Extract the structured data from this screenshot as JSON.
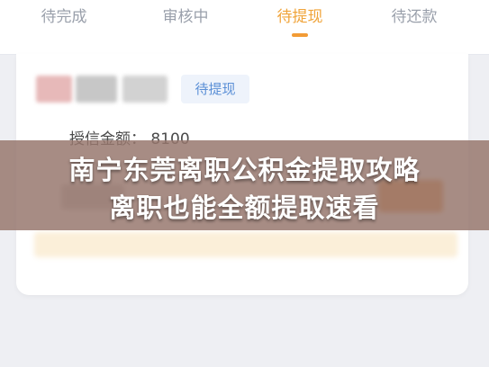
{
  "tabs": [
    {
      "label": "待完成",
      "active": false
    },
    {
      "label": "审核中",
      "active": false
    },
    {
      "label": "待提现",
      "active": true
    },
    {
      "label": "待还款",
      "active": false
    }
  ],
  "card": {
    "status_tag": "待提现",
    "credit_label": "授信金额：",
    "credit_value": "8100"
  },
  "overlay": {
    "line1": "南宁东莞离职公积金提取攻略",
    "line2": "离职也能全额提取速看"
  },
  "colors": {
    "accent": "#f29b35",
    "tag_text": "#5a8fd6",
    "overlay": "#96766c"
  }
}
